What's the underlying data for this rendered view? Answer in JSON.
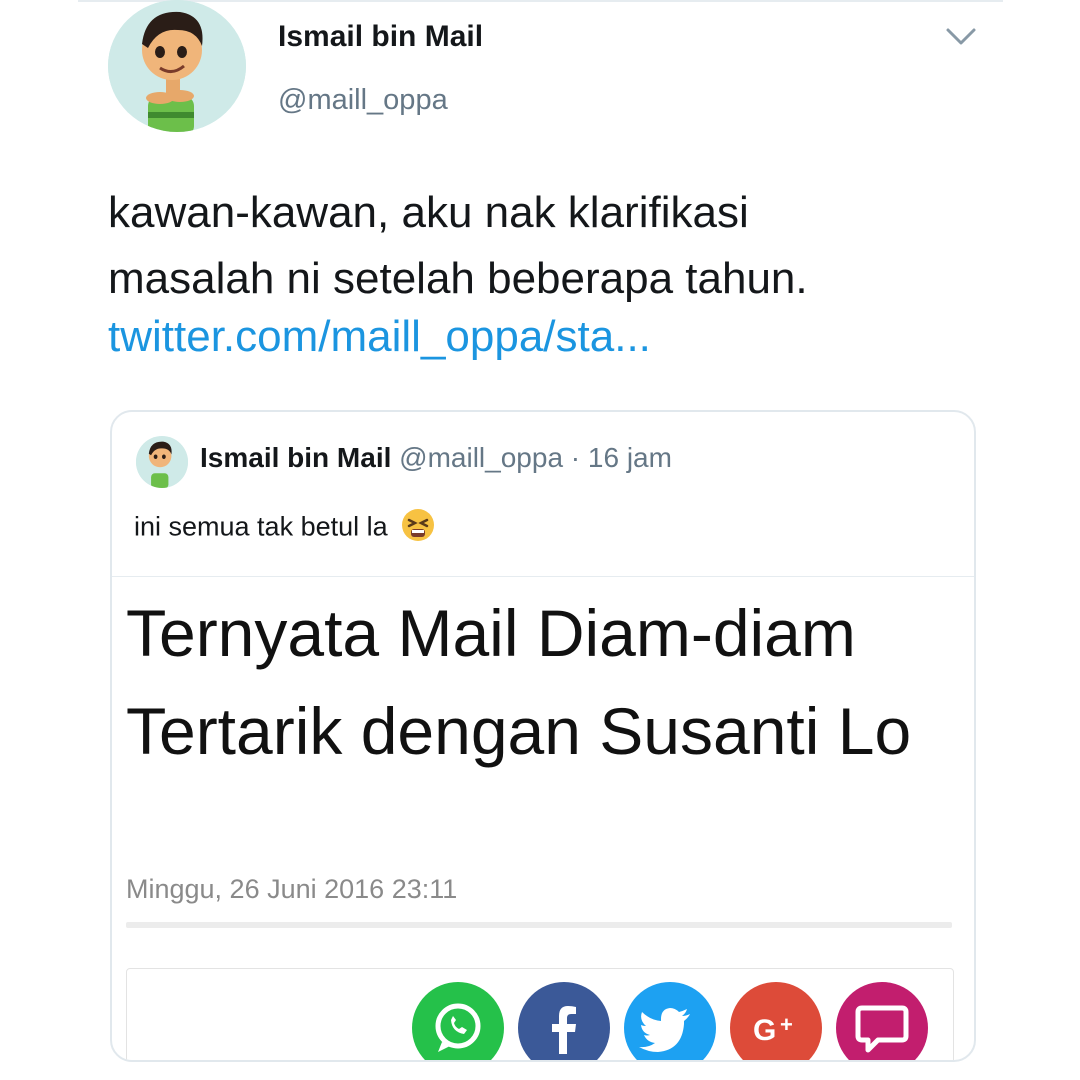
{
  "tweet": {
    "display_name": "Ismail bin Mail",
    "handle": "@maill_oppa",
    "text_line_1": "kawan-kawan, aku nak klarifikasi",
    "text_line_2": "masalah ni setelah beberapa tahun.",
    "link": "twitter.com/maill_oppa/sta..."
  },
  "quoted_tweet": {
    "display_name": "Ismail bin Mail",
    "handle": "@maill_oppa",
    "separator": " · ",
    "time": "16 jam",
    "text": "ini semua tak betul la",
    "emoji": "tired-face-emoji"
  },
  "article": {
    "headline": "Ternyata Mail Diam-diam Tertarik dengan Susanti Lo",
    "date": "Minggu, 26 Juni 2016 23:11"
  },
  "share_buttons": [
    {
      "name": "whatsapp",
      "color": "#25c14a"
    },
    {
      "name": "facebook",
      "color": "#3b5998"
    },
    {
      "name": "twitter",
      "color": "#1da1f2"
    },
    {
      "name": "google-plus",
      "color": "#dd4b39"
    },
    {
      "name": "comment",
      "color": "#c21e6e"
    }
  ],
  "colors": {
    "link": "#1b95e0",
    "secondary_text": "#657786",
    "border": "#e1e8ed"
  }
}
